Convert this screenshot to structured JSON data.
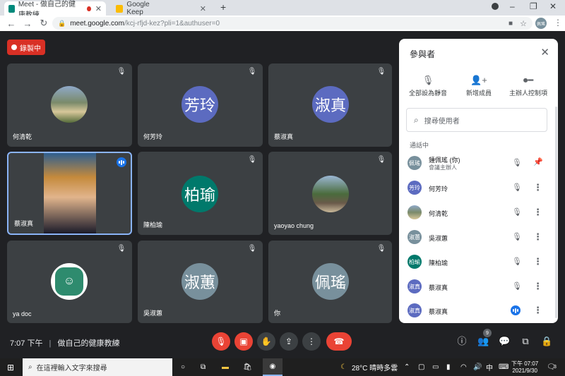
{
  "browser": {
    "tabs": [
      {
        "title": "Meet - 做自己的健康教練",
        "active": true,
        "recording": true
      },
      {
        "title": "Google Keep",
        "active": false
      }
    ],
    "new_tab": "+",
    "url_host": "meet.google.com",
    "url_path": "/kcj-rfjd-kez?pli=1&authuser=0",
    "profile": "佩瑤"
  },
  "meeting": {
    "recording_label": "錄製中",
    "time": "7:07 下午",
    "separator": "|",
    "title": "做自己的健康教練",
    "participant_count": "9"
  },
  "tiles": [
    {
      "name": "何清乾",
      "type": "photo"
    },
    {
      "name": "何芳玲",
      "initials": "芳玲",
      "color": "#5c6bc0"
    },
    {
      "name": "蔡淑真",
      "initials": "淑真",
      "color": "#5c6bc0"
    },
    {
      "name": "蔡淑真",
      "type": "video",
      "speaking": true
    },
    {
      "name": "陳柏瑜",
      "initials": "柏瑜",
      "color": "#00796b"
    },
    {
      "name": "yaoyao chung",
      "type": "photo"
    },
    {
      "name": "ya doc",
      "type": "logo"
    },
    {
      "name": "吳淑蕙",
      "initials": "淑蕙",
      "color": "#78909c"
    },
    {
      "name": "你",
      "initials": "佩瑤",
      "color": "#78909c"
    }
  ],
  "panel": {
    "title": "參與者",
    "actions": [
      {
        "label": "全部設為靜音",
        "icon": "mic-off-icon"
      },
      {
        "label": "新增成員",
        "icon": "add-person-icon"
      },
      {
        "label": "主辦人控制項",
        "icon": "toggle-icon"
      }
    ],
    "search_placeholder": "搜尋使用者",
    "section": "通話中",
    "participants": [
      {
        "initials": "佩瑤",
        "name": "鍾佩瑤 (你)",
        "sub": "會議主辦人",
        "color": "#78909c",
        "action": "pin"
      },
      {
        "initials": "芳玲",
        "name": "何芳玲",
        "color": "#5c6bc0"
      },
      {
        "initials": "",
        "name": "何清乾",
        "color": "#607d8b",
        "photo": true
      },
      {
        "initials": "淑蕙",
        "name": "吳淑蕙",
        "color": "#78909c"
      },
      {
        "initials": "柏瑜",
        "name": "陳柏瑜",
        "color": "#00796b"
      },
      {
        "initials": "淑真",
        "name": "蔡淑真",
        "color": "#5c6bc0"
      },
      {
        "initials": "淑真",
        "name": "蔡淑真",
        "color": "#5c6bc0",
        "speaking": true
      }
    ]
  },
  "taskbar": {
    "search_placeholder": "在這裡輸入文字來搜尋",
    "weather": "28°C 晴時多雲",
    "ime": "中",
    "time": "下午 07:07",
    "date": "2021/9/30",
    "notifications": "3"
  }
}
